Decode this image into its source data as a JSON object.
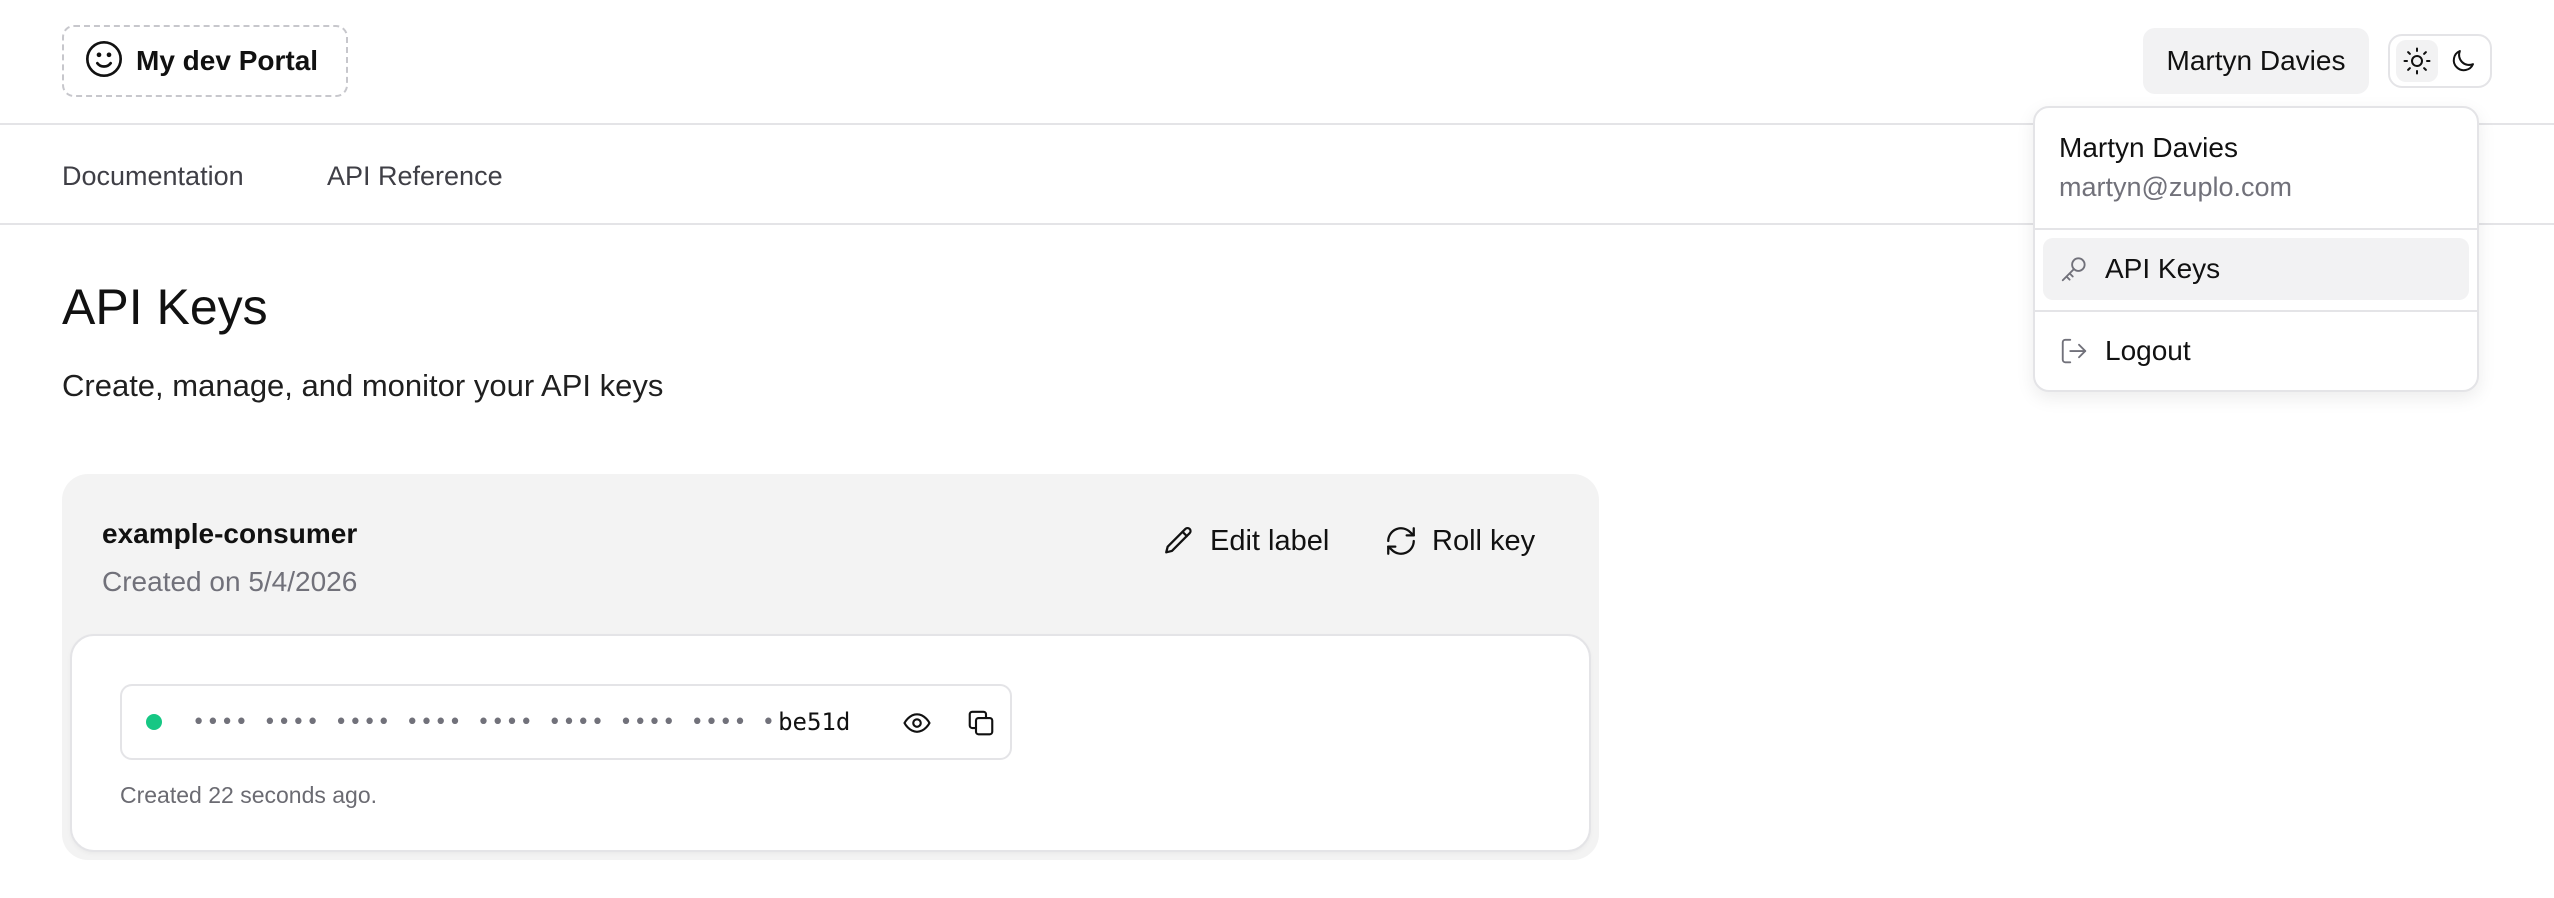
{
  "header": {
    "logo_text": "My dev Portal",
    "logo_icon": "smiley-icon",
    "user_button_label": "Martyn Davies",
    "theme_toggle": {
      "options": [
        "light",
        "dark"
      ],
      "selected": "light"
    }
  },
  "nav": {
    "items": [
      {
        "label": "Documentation"
      },
      {
        "label": "API Reference"
      }
    ]
  },
  "main": {
    "title": "API Keys",
    "subtitle": "Create, manage, and monitor your API keys",
    "consumer": {
      "name": "example-consumer",
      "created": "Created on 5/4/2026",
      "edit_label": "Edit label",
      "roll_label": "Roll key",
      "key": {
        "masked": "•••• •••• •••• •••• •••• •••• •••• •••• •",
        "suffix": "be51d",
        "status_color": "#16c784",
        "created": "Created 22 seconds ago."
      }
    }
  },
  "dropdown": {
    "name": "Martyn Davies",
    "email": "martyn@zuplo.com",
    "items": [
      {
        "label": "API Keys",
        "icon": "key-icon"
      },
      {
        "label": "Logout",
        "icon": "logout-icon"
      }
    ]
  }
}
